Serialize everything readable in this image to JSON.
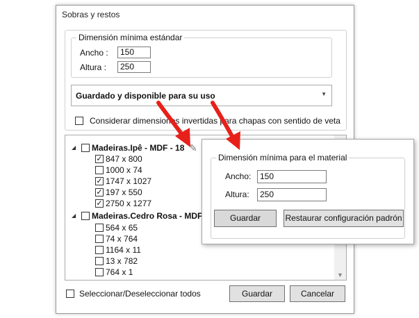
{
  "window": {
    "title": "Sobras y restos"
  },
  "min_dimension_standard": {
    "legend": "Dimensión mínima estándar",
    "width_label": "Ancho :",
    "width_value": "150",
    "height_label": "Altura :",
    "height_value": "250"
  },
  "storage_combo": {
    "selected": "Guardado y disponible para su uso"
  },
  "inverted_checkbox": {
    "label": "Considerar dimensiones invertidas para chapas con sentido de veta",
    "checked": false
  },
  "tree": {
    "materials": [
      {
        "name": "Madeiras.Ipê - MDF - 18",
        "checked": false,
        "expanded": true,
        "items": [
          {
            "label": "847 x 800",
            "checked": true
          },
          {
            "label": "1000 x 74",
            "checked": false
          },
          {
            "label": "1747 x 1027",
            "checked": true
          },
          {
            "label": "197 x 550",
            "checked": true
          },
          {
            "label": "2750 x 1277",
            "checked": true
          }
        ]
      },
      {
        "name": "Madeiras.Cedro Rosa - MDF",
        "checked": false,
        "expanded": true,
        "items": [
          {
            "label": "564 x 65",
            "checked": false
          },
          {
            "label": "74 x 764",
            "checked": false
          },
          {
            "label": "1164 x 11",
            "checked": false
          },
          {
            "label": "13 x 782",
            "checked": false
          },
          {
            "label": "764 x 1",
            "checked": false
          }
        ]
      }
    ]
  },
  "select_all": {
    "label": "Seleccionar/Deseleccionar todos",
    "checked": false
  },
  "buttons": {
    "save": "Guardar",
    "cancel": "Cancelar"
  },
  "material_popup": {
    "legend": "Dimensión mínima para el material",
    "width_label": "Ancho:",
    "width_value": "150",
    "height_label": "Altura:",
    "height_value": "250",
    "save_button": "Guardar",
    "restore_button": "Restaurar configuración padrón"
  },
  "colors": {
    "annotation_arrow": "#e8201a",
    "button_face": "#e1e1e1",
    "border": "#aaaaaa"
  },
  "icons": {
    "edit": "pencil-icon",
    "expand": "triangle-expanded-icon",
    "dropdown": "chevron-down-icon"
  }
}
